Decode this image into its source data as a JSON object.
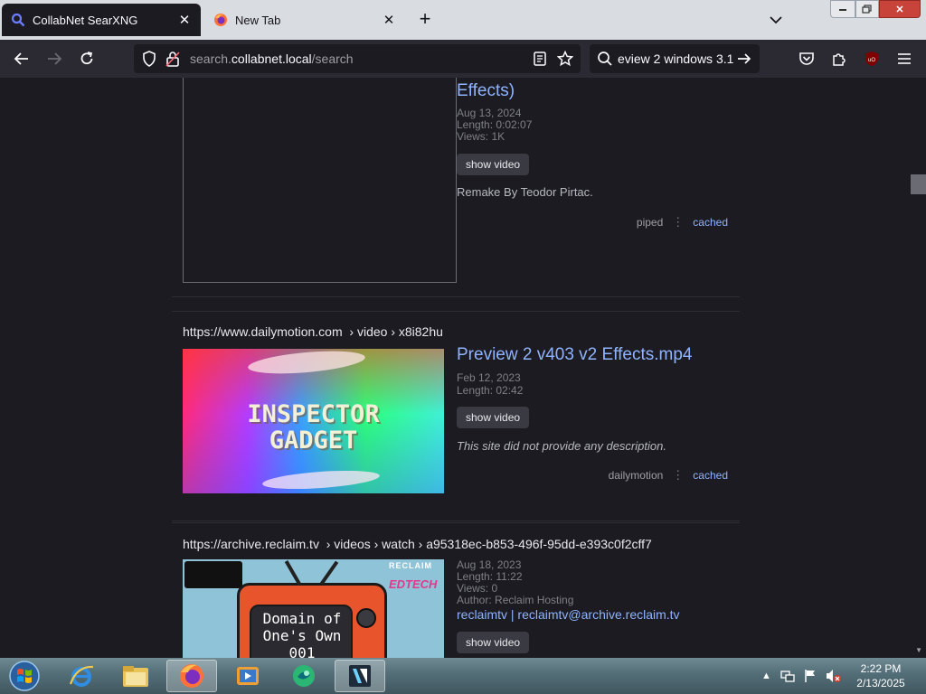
{
  "browser": {
    "tabs": [
      {
        "title": "CollabNet SearXNG",
        "active": true
      },
      {
        "title": "New Tab",
        "active": false
      }
    ],
    "url_prefix": "search.",
    "url_host": "collabnet.local",
    "url_path": "/search",
    "search_query": "eview 2 windows 3.1"
  },
  "results": [
    {
      "title_partial": "Effects)",
      "date": "Aug 13, 2024",
      "length": "Length: 0:02:07",
      "views": "Views: 1K",
      "show_video": "show video",
      "description": "Remake By Teodor Pirtac.",
      "engine": "piped",
      "cached": "cached"
    },
    {
      "url": "https://www.dailymotion.com",
      "breadcrumb": "› video › x8i82hu",
      "title": "Preview 2 v403 v2 Effects.mp4",
      "thumb_text_line1": "INSPECTOR",
      "thumb_text_line2": "GADGET",
      "date": "Feb 12, 2023",
      "length": "Length: 02:42",
      "show_video": "show video",
      "description": "This site did not provide any description.",
      "engine": "dailymotion",
      "cached": "cached"
    },
    {
      "url": "https://archive.reclaim.tv",
      "breadcrumb": "› videos › watch › a95318ec-b853-496f-95dd-e393c0f2cff7",
      "thumb_text_line1": "Domain of",
      "thumb_text_line2": "One's Own",
      "thumb_text_line3": "001",
      "thumb_brand1": "RECLAIM",
      "thumb_brand2": "EDTECH",
      "date": "Aug 18, 2023",
      "length": "Length: 11:22",
      "views": "Views: 0",
      "author": "Author: Reclaim Hosting",
      "author_link": "reclaimtv | reclaimtv@archive.reclaim.tv",
      "show_video": "show video"
    }
  ],
  "taskbar": {
    "time": "2:22 PM",
    "date": "2/13/2025"
  },
  "colors": {
    "link": "#8fb3ff",
    "page_bg": "#1c1b22",
    "toolbar_bg": "#2b2a33"
  }
}
